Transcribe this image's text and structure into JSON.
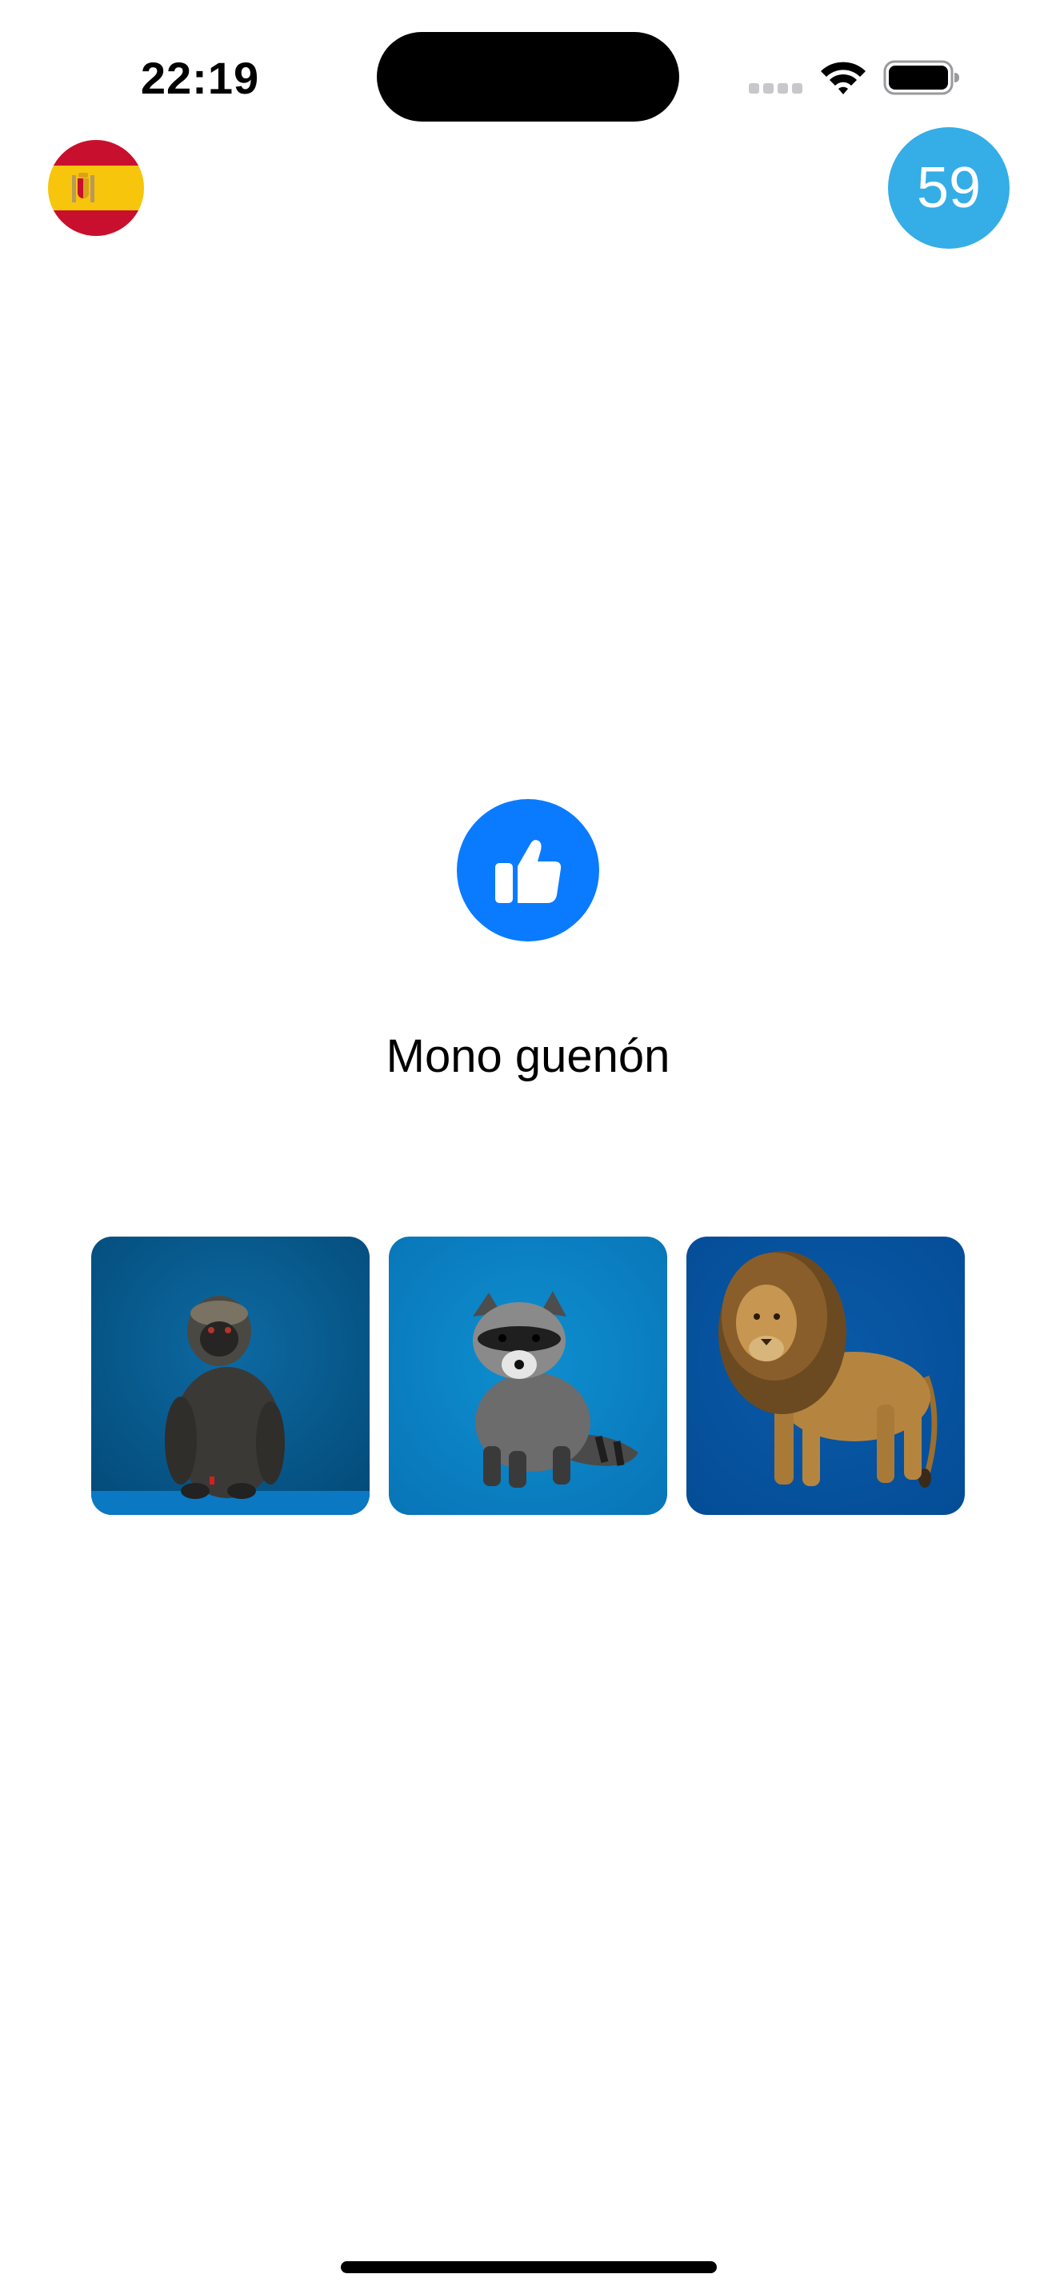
{
  "status_bar": {
    "time": "22:19",
    "icons": [
      "cellular-signal-icon",
      "wifi-icon",
      "battery-icon"
    ]
  },
  "header": {
    "language_flag": "spain-flag-icon",
    "score": "59",
    "score_color": "#35ade6"
  },
  "feedback": {
    "icon": "thumbs-up-icon",
    "color": "#0a7bff",
    "word": "Mono guenón"
  },
  "answer_options": [
    {
      "image": "monkey-image"
    },
    {
      "image": "raccoon-image"
    },
    {
      "image": "lion-image"
    }
  ]
}
